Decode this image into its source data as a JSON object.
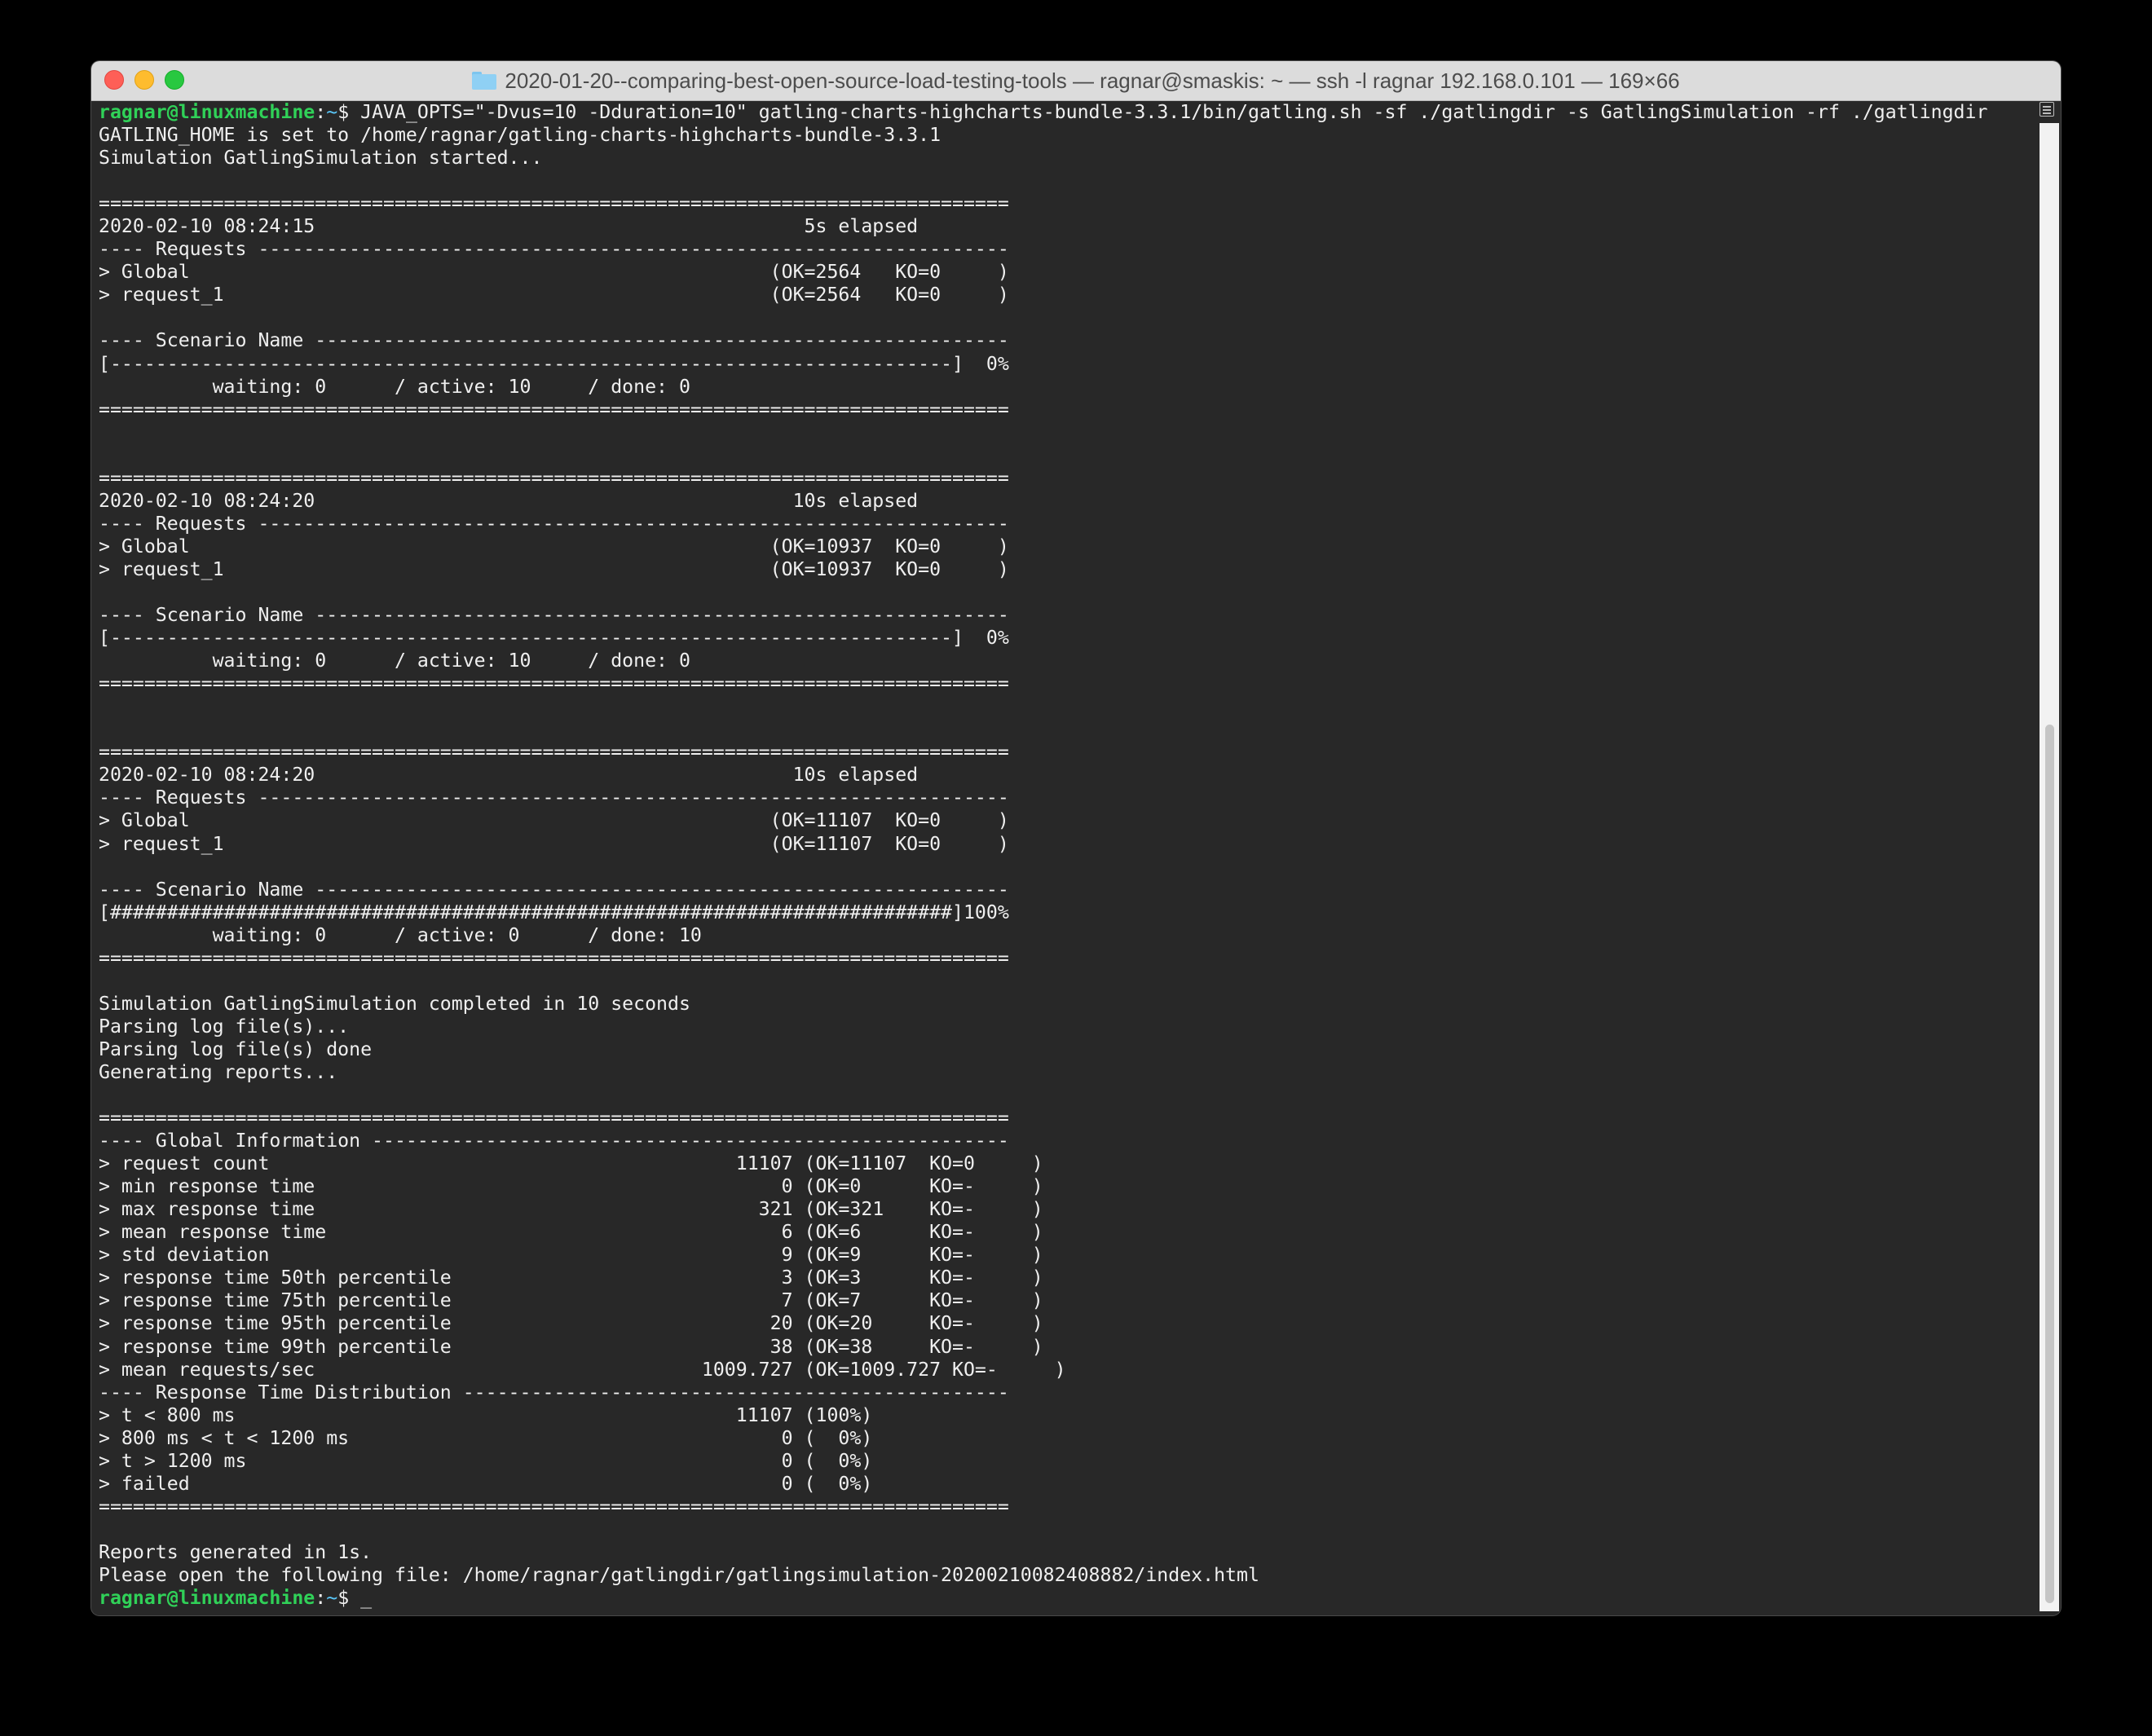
{
  "window": {
    "title": "2020-01-20--comparing-best-open-source-load-testing-tools — ragnar@smaskis: ~ — ssh -l ragnar 192.168.0.101 — 169×66"
  },
  "prompt": {
    "user_host": "ragnar@linuxmachine",
    "separator": ":",
    "path": "~",
    "symbol": "$"
  },
  "command": " JAVA_OPTS=\"-Dvus=10 -Dduration=10\" gatling-charts-highcharts-bundle-3.3.1/bin/gatling.sh -sf ./gatlingdir -s GatlingSimulation -rf ./gatlingdir",
  "output": [
    "GATLING_HOME is set to /home/ragnar/gatling-charts-highcharts-bundle-3.3.1",
    "Simulation GatlingSimulation started...",
    "",
    "================================================================================",
    "2020-02-10 08:24:15                                           5s elapsed",
    "---- Requests ------------------------------------------------------------------",
    "> Global                                                   (OK=2564   KO=0     )",
    "> request_1                                                (OK=2564   KO=0     )",
    "",
    "---- Scenario Name -------------------------------------------------------------",
    "[--------------------------------------------------------------------------]  0%",
    "          waiting: 0      / active: 10     / done: 0",
    "================================================================================",
    "",
    "",
    "================================================================================",
    "2020-02-10 08:24:20                                          10s elapsed",
    "---- Requests ------------------------------------------------------------------",
    "> Global                                                   (OK=10937  KO=0     )",
    "> request_1                                                (OK=10937  KO=0     )",
    "",
    "---- Scenario Name -------------------------------------------------------------",
    "[--------------------------------------------------------------------------]  0%",
    "          waiting: 0      / active: 10     / done: 0",
    "================================================================================",
    "",
    "",
    "================================================================================",
    "2020-02-10 08:24:20                                          10s elapsed",
    "---- Requests ------------------------------------------------------------------",
    "> Global                                                   (OK=11107  KO=0     )",
    "> request_1                                                (OK=11107  KO=0     )",
    "",
    "---- Scenario Name -------------------------------------------------------------",
    "[##########################################################################]100%",
    "          waiting: 0      / active: 0      / done: 10",
    "================================================================================",
    "",
    "Simulation GatlingSimulation completed in 10 seconds",
    "Parsing log file(s)...",
    "Parsing log file(s) done",
    "Generating reports...",
    "",
    "================================================================================",
    "---- Global Information --------------------------------------------------------",
    "> request count                                         11107 (OK=11107  KO=0     )",
    "> min response time                                         0 (OK=0      KO=-     )",
    "> max response time                                       321 (OK=321    KO=-     )",
    "> mean response time                                        6 (OK=6      KO=-     )",
    "> std deviation                                             9 (OK=9      KO=-     )",
    "> response time 50th percentile                             3 (OK=3      KO=-     )",
    "> response time 75th percentile                             7 (OK=7      KO=-     )",
    "> response time 95th percentile                            20 (OK=20     KO=-     )",
    "> response time 99th percentile                            38 (OK=38     KO=-     )",
    "> mean requests/sec                                  1009.727 (OK=1009.727 KO=-     )",
    "---- Response Time Distribution ------------------------------------------------",
    "> t < 800 ms                                            11107 (100%)",
    "> 800 ms < t < 1200 ms                                      0 (  0%)",
    "> t > 1200 ms                                               0 (  0%)",
    "> failed                                                    0 (  0%)",
    "================================================================================",
    "",
    "Reports generated in 1s.",
    "Please open the following file: /home/ragnar/gatlingdir/gatlingsimulation-20200210082408882/index.html"
  ],
  "cursor": " _",
  "colors": {
    "terminal_bg": "#282828",
    "prompt_user": "#30d158",
    "prompt_path": "#5ac8fa",
    "text": "#efefef"
  }
}
